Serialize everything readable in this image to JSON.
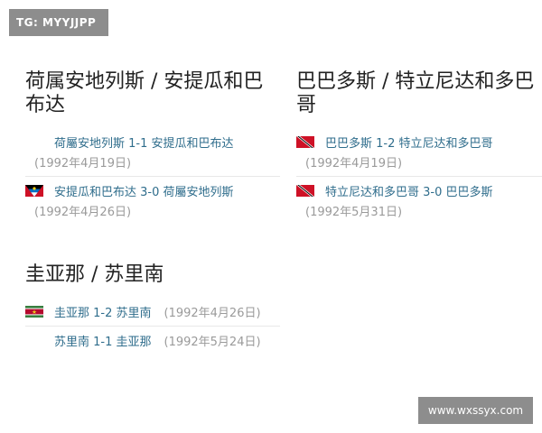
{
  "watermark_top": "TG: MYYJJPP",
  "watermark_bottom": "www.wxssyx.com",
  "sections": [
    {
      "title": "荷属安地列斯 / 安提瓜和巴布达",
      "matches": [
        {
          "text": "荷屬安地列斯 1-1 安提瓜和巴布达",
          "date": "(1992年4月19日)",
          "flag": ""
        },
        {
          "text": "安提瓜和巴布达 3-0 荷屬安地列斯",
          "date": "(1992年4月26日)",
          "flag": "antigua-flag-icon"
        }
      ]
    },
    {
      "title": "巴巴多斯 / 特立尼达和多巴哥",
      "matches": [
        {
          "text": "巴巴多斯 1-2 特立尼达和多巴哥",
          "date": "(1992年4月19日)",
          "flag": "trinidad-flag-icon"
        },
        {
          "text": "特立尼达和多巴哥 3-0 巴巴多斯",
          "date": "(1992年5月31日)",
          "flag": "trinidad-flag-icon"
        }
      ]
    },
    {
      "title": "圭亚那 / 苏里南",
      "matches": [
        {
          "text": "圭亚那 1-2 苏里南",
          "date": "(1992年4月26日)",
          "flag": "suriname-flag-icon"
        },
        {
          "text": "苏里南 1-1 圭亚那",
          "date": "(1992年5月24日)",
          "flag": ""
        }
      ]
    }
  ]
}
